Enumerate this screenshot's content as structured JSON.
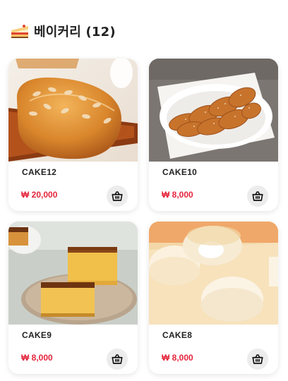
{
  "header": {
    "icon": "cake-slice-icon",
    "title": "베이커리 (12)"
  },
  "products": [
    {
      "name": "CAKE12",
      "price": "₩ 20,000",
      "image": "bread-loaf-almond"
    },
    {
      "name": "CAKE10",
      "price": "₩ 8,000",
      "image": "sugar-twist-donut"
    },
    {
      "name": "CAKE9",
      "price": "₩ 8,000",
      "image": "castella-sponge-cake"
    },
    {
      "name": "CAKE8",
      "price": "₩ 8,000",
      "image": "cream-filled-buns"
    }
  ],
  "colors": {
    "price": "#e5243b",
    "cart_bg": "#ececec",
    "card_bg": "#ffffff"
  }
}
